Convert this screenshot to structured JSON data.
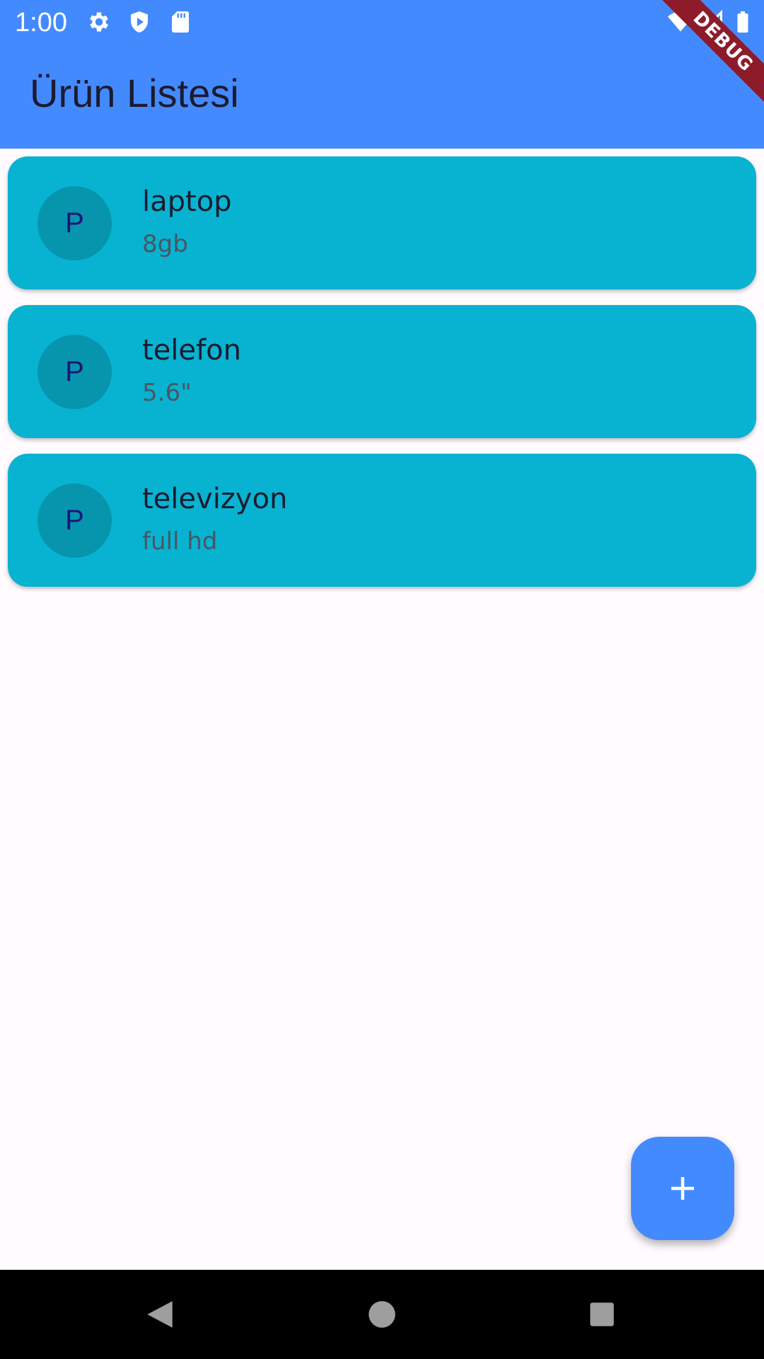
{
  "status_bar": {
    "time": "1:00",
    "icons": [
      "settings-icon",
      "play-protect-icon",
      "sd-card-icon",
      "wifi-icon",
      "signal-icon",
      "battery-icon"
    ]
  },
  "debug_banner": {
    "label": "DEBUG"
  },
  "app_bar": {
    "title": "Ürün Listesi"
  },
  "products": [
    {
      "avatar": "P",
      "name": "laptop",
      "description": "8gb"
    },
    {
      "avatar": "P",
      "name": "telefon",
      "description": "5.6\""
    },
    {
      "avatar": "P",
      "name": "televizyon",
      "description": "full hd"
    }
  ],
  "fab": {
    "icon": "add-icon"
  },
  "nav_bar": {
    "buttons": [
      "back-icon",
      "home-icon",
      "recents-icon"
    ]
  },
  "colors": {
    "app_bar": "#448aff",
    "card": "#07b3d1",
    "avatar": "#0795ae",
    "avatar_text": "#1f1577",
    "background": "#fffbff",
    "debug_ribbon": "#8e1b2a"
  }
}
